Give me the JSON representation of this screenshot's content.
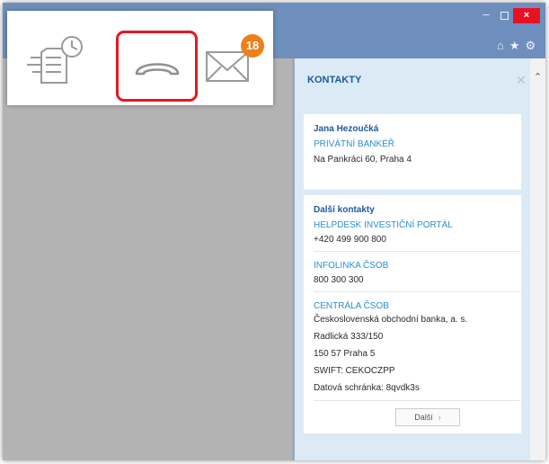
{
  "window": {
    "minimize_glyph": "–",
    "close_glyph": "×",
    "header_icons": [
      "home-icon",
      "star-icon",
      "gear-icon"
    ]
  },
  "toolbar": {
    "icons": [
      "documents-clock-icon",
      "phone-icon",
      "mail-icon"
    ],
    "mail_badge": "18",
    "accent": "#ef7f1a",
    "highlight_color": "#e4181f"
  },
  "contacts": {
    "title": "KONTAKTY",
    "banker": {
      "name": "Jana Hezoučká",
      "role": "PRIVÁTNÍ BANKÉŘ",
      "address": "Na Pankráci 60, Praha 4"
    },
    "other": {
      "heading": "Další kontakty",
      "entries": [
        {
          "label": "HELPDESK INVESTIČNÍ PORTÁL",
          "lines": [
            "+420 499 900 800"
          ]
        },
        {
          "label": "INFOLINKA ČSOB",
          "lines": [
            "800 300 300"
          ]
        },
        {
          "label": "CENTRÁLA ČSOB",
          "lines": [
            "Československá obchodní banka, a. s.",
            "Radlická 333/150",
            "150 57 Praha 5",
            "SWIFT: CEKOCZPP",
            "Datová schránka: 8qvdk3s"
          ]
        }
      ],
      "more_label": "Další"
    }
  },
  "colors": {
    "header_bar": "#6e8fbd",
    "panel_bg": "#dbeaf5",
    "title_blue": "#1d5aa0",
    "role_blue": "#2a8fce"
  }
}
